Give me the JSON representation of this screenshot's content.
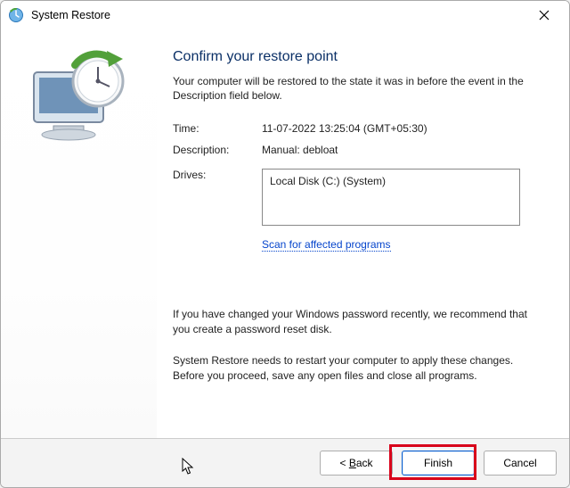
{
  "titlebar": {
    "title": "System Restore"
  },
  "heading": "Confirm your restore point",
  "intro": "Your computer will be restored to the state it was in before the event in the Description field below.",
  "fields": {
    "time_label": "Time:",
    "time_value": "11-07-2022 13:25:04 (GMT+05:30)",
    "desc_label": "Description:",
    "desc_value": "Manual: debloat",
    "drives_label": "Drives:"
  },
  "drives": {
    "value": "Local Disk (C:) (System)"
  },
  "scan_link": "Scan for affected programs",
  "note": "If you have changed your Windows password recently, we recommend that you create a password reset disk.",
  "warn": "System Restore needs to restart your computer to apply these changes. Before you proceed, save any open files and close all programs.",
  "footer": {
    "back_prefix": "< ",
    "back_char": "B",
    "back_rest": "ack",
    "finish": "Finish",
    "cancel": "Cancel"
  }
}
